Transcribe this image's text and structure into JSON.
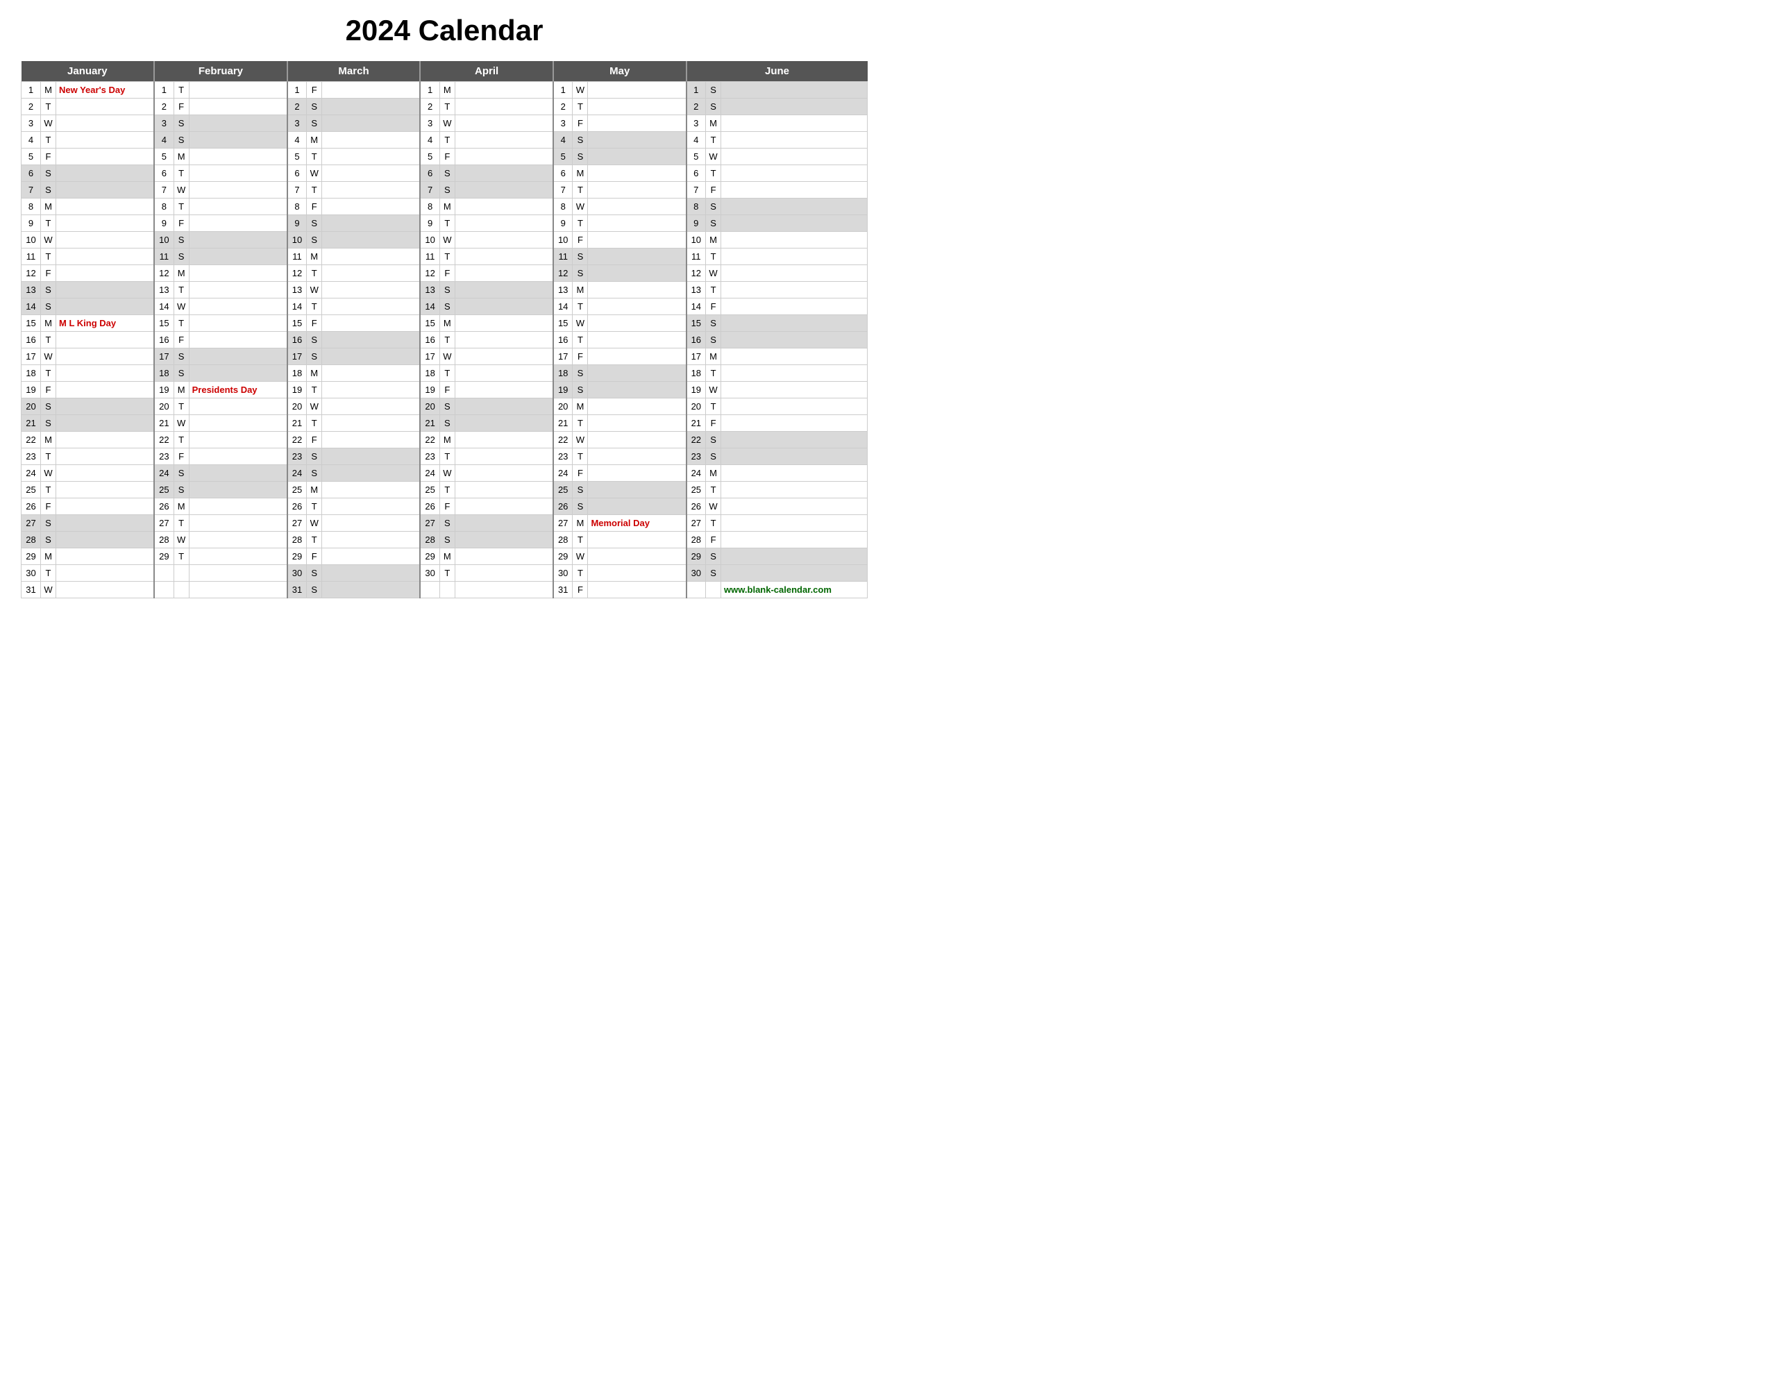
{
  "title": "2024 Calendar",
  "months": [
    "January",
    "February",
    "March",
    "April",
    "May",
    "June"
  ],
  "holidays": {
    "jan_1": "New Year's Day",
    "jan_15": "M L King Day",
    "feb_19": "Presidents Day",
    "may_27": "Memorial Day"
  },
  "website": "www.blank-calendar.com",
  "days": {
    "jan": [
      "M",
      "T",
      "W",
      "T",
      "F",
      "S",
      "S",
      "M",
      "T",
      "W",
      "T",
      "F",
      "S",
      "S",
      "M",
      "T",
      "W",
      "T",
      "F",
      "S",
      "S",
      "M",
      "T",
      "W",
      "T",
      "F",
      "S",
      "S",
      "M",
      "T",
      "W"
    ],
    "feb": [
      "T",
      "F",
      "S",
      "S",
      "M",
      "T",
      "W",
      "T",
      "F",
      "S",
      "S",
      "M",
      "T",
      "W",
      "T",
      "F",
      "S",
      "S",
      "M",
      "T",
      "W",
      "T",
      "F",
      "S",
      "S",
      "M",
      "T",
      "W",
      "T",
      ""
    ],
    "mar": [
      "F",
      "S",
      "S",
      "M",
      "T",
      "W",
      "T",
      "F",
      "S",
      "S",
      "M",
      "T",
      "W",
      "T",
      "F",
      "S",
      "S",
      "M",
      "T",
      "W",
      "T",
      "F",
      "S",
      "S",
      "M",
      "T",
      "W",
      "T",
      "F",
      "S",
      "S"
    ],
    "apr": [
      "M",
      "T",
      "W",
      "T",
      "F",
      "S",
      "S",
      "M",
      "T",
      "W",
      "T",
      "F",
      "S",
      "S",
      "M",
      "T",
      "W",
      "T",
      "F",
      "S",
      "S",
      "M",
      "T",
      "W",
      "T",
      "F",
      "S",
      "S",
      "M",
      "T",
      ""
    ],
    "may": [
      "W",
      "T",
      "F",
      "S",
      "S",
      "M",
      "T",
      "W",
      "T",
      "F",
      "S",
      "S",
      "M",
      "T",
      "W",
      "T",
      "F",
      "S",
      "S",
      "M",
      "T",
      "W",
      "T",
      "F",
      "S",
      "S",
      "M",
      "T",
      "W",
      "T",
      "F"
    ],
    "jun": [
      "S",
      "S",
      "M",
      "T",
      "W",
      "T",
      "F",
      "S",
      "S",
      "M",
      "T",
      "W",
      "T",
      "F",
      "S",
      "S",
      "M",
      "T",
      "W",
      "T",
      "F",
      "S",
      "S",
      "M",
      "T",
      "W",
      "T",
      "F",
      "S",
      "S",
      ""
    ]
  }
}
